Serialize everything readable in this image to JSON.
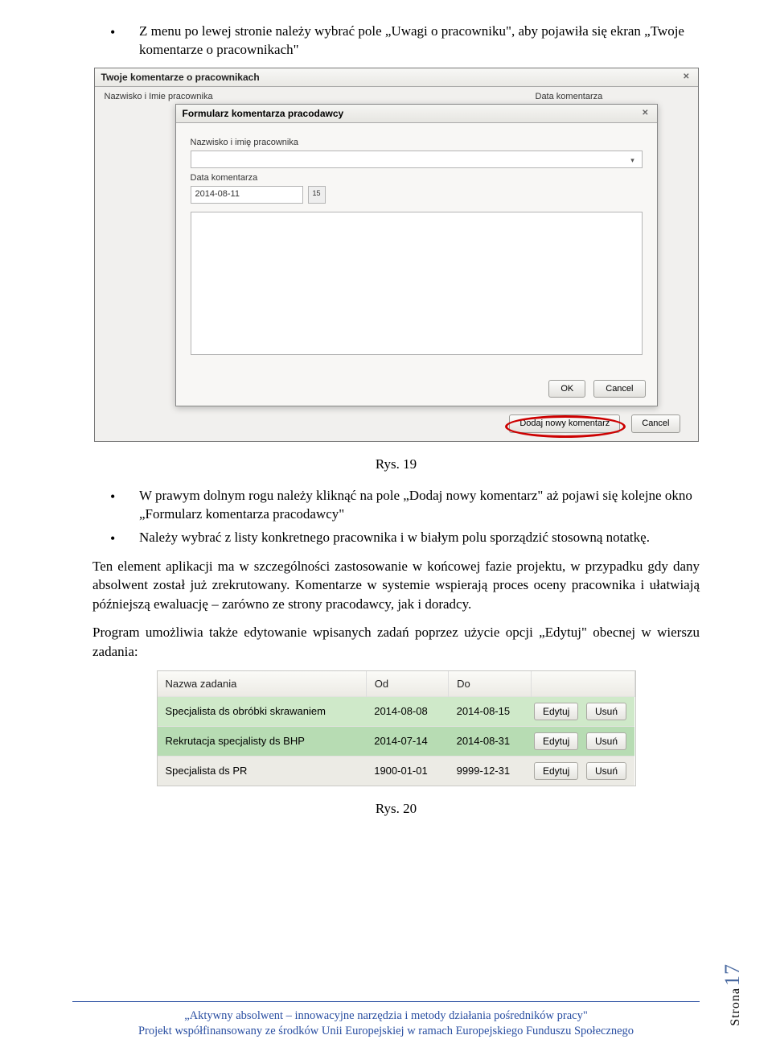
{
  "bullets_top": {
    "b1": "Z menu po lewej stronie należy wybrać pole „Uwagi o pracowniku\", aby pojawiła się ekran „Twoje komentarze o pracownikach\""
  },
  "shot1": {
    "outer": {
      "title": "Twoje komentarze o pracownikach",
      "col1": "Nazwisko i Imie pracownika",
      "col2": "Data komentarza",
      "add_btn": "Dodaj nowy komentarz",
      "cancel_btn": "Cancel"
    },
    "inner": {
      "title": "Formularz komentarza pracodawcy",
      "label_name": "Nazwisko i imię pracownika",
      "label_date": "Data komentarza",
      "date_value": "2014-08-11",
      "cal_icon": "15",
      "ok": "OK",
      "cancel": "Cancel"
    }
  },
  "fig1": "Rys. 19",
  "bullets_mid": {
    "b1": "W prawym dolnym rogu należy kliknąć na pole „Dodaj nowy komentarz\" aż pojawi się kolejne okno „Formularz komentarza pracodawcy\"",
    "b2": "Należy wybrać z listy konkretnego pracownika i w białym polu sporządzić stosowną notatkę."
  },
  "para1": "Ten element aplikacji ma w szczególności zastosowanie w końcowej fazie projektu, w przypadku gdy dany absolwent został już zrekrutowany. Komentarze w systemie wspierają proces oceny pracownika i ułatwiają późniejszą ewaluację – zarówno ze strony pracodawcy, jak i doradcy.",
  "para2": "Program umożliwia także edytowanie wpisanych zadań poprzez użycie opcji „Edytuj\" obecnej w wierszu zadania:",
  "shot2": {
    "headers": {
      "c1": "Nazwa zadania",
      "c2": "Od",
      "c3": "Do"
    },
    "rows": [
      {
        "name": "Specjalista ds obróbki skrawaniem",
        "od": "2014-08-08",
        "do": "2014-08-15"
      },
      {
        "name": "Rekrutacja specjalisty ds BHP",
        "od": "2014-07-14",
        "do": "2014-08-31"
      },
      {
        "name": "Specjalista ds PR",
        "od": "1900-01-01",
        "do": "9999-12-31"
      }
    ],
    "edit": "Edytuj",
    "del": "Usuń"
  },
  "fig2": "Rys. 20",
  "side": {
    "label": "Strona",
    "num": "17"
  },
  "footer": {
    "l1": "„Aktywny absolwent – innowacyjne narzędzia i metody działania pośredników pracy\"",
    "l2": "Projekt współfinansowany ze środków Unii Europejskiej w ramach Europejskiego Funduszu Społecznego"
  }
}
